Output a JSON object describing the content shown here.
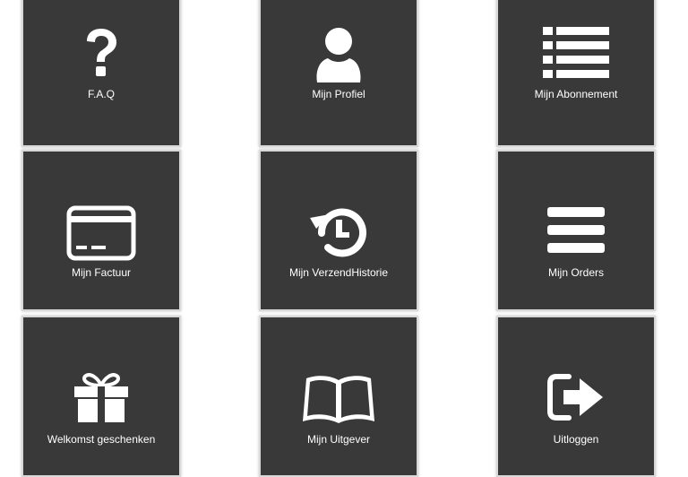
{
  "tiles": [
    {
      "label": "F.A.Q",
      "icon": "question-icon"
    },
    {
      "label": "Mijn Profiel",
      "icon": "user-icon"
    },
    {
      "label": "Mijn Abonnement",
      "icon": "list-icon"
    },
    {
      "label": "Mijn Factuur",
      "icon": "credit-card-icon"
    },
    {
      "label": "Mijn VerzendHistorie",
      "icon": "history-icon"
    },
    {
      "label": "Mijn Orders",
      "icon": "bars-icon"
    },
    {
      "label": "Welkomst geschenken",
      "icon": "gift-icon"
    },
    {
      "label": "Mijn Uitgever",
      "icon": "book-icon"
    },
    {
      "label": "Uitloggen",
      "icon": "sign-out-icon"
    }
  ],
  "colors": {
    "tile_background": "#3a3939",
    "tile_border": "#d8d8d8",
    "icon_and_text": "#ffffff"
  }
}
